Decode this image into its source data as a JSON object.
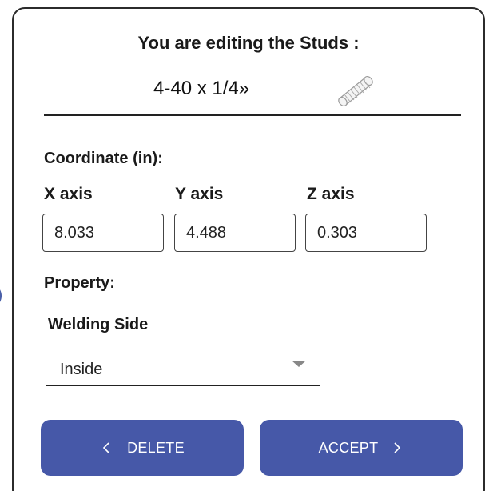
{
  "header": {
    "title": "You are editing the Studs :",
    "part_name": "4-40 x 1/4»",
    "part_icon": "stud-icon"
  },
  "coordinate": {
    "label": "Coordinate (in):",
    "x_label": "X axis",
    "y_label": "Y axis",
    "z_label": "Z axis",
    "x_value": "8.033",
    "y_value": "4.488",
    "z_value": "0.303"
  },
  "property": {
    "label": "Property:",
    "welding_side_label": "Welding Side",
    "welding_side_value": "Inside"
  },
  "actions": {
    "delete_label": "DELETE",
    "accept_label": "ACCEPT"
  },
  "colors": {
    "button_bg": "#4658a8",
    "border": "#2b2b2b",
    "text": "#1a1a1a"
  }
}
